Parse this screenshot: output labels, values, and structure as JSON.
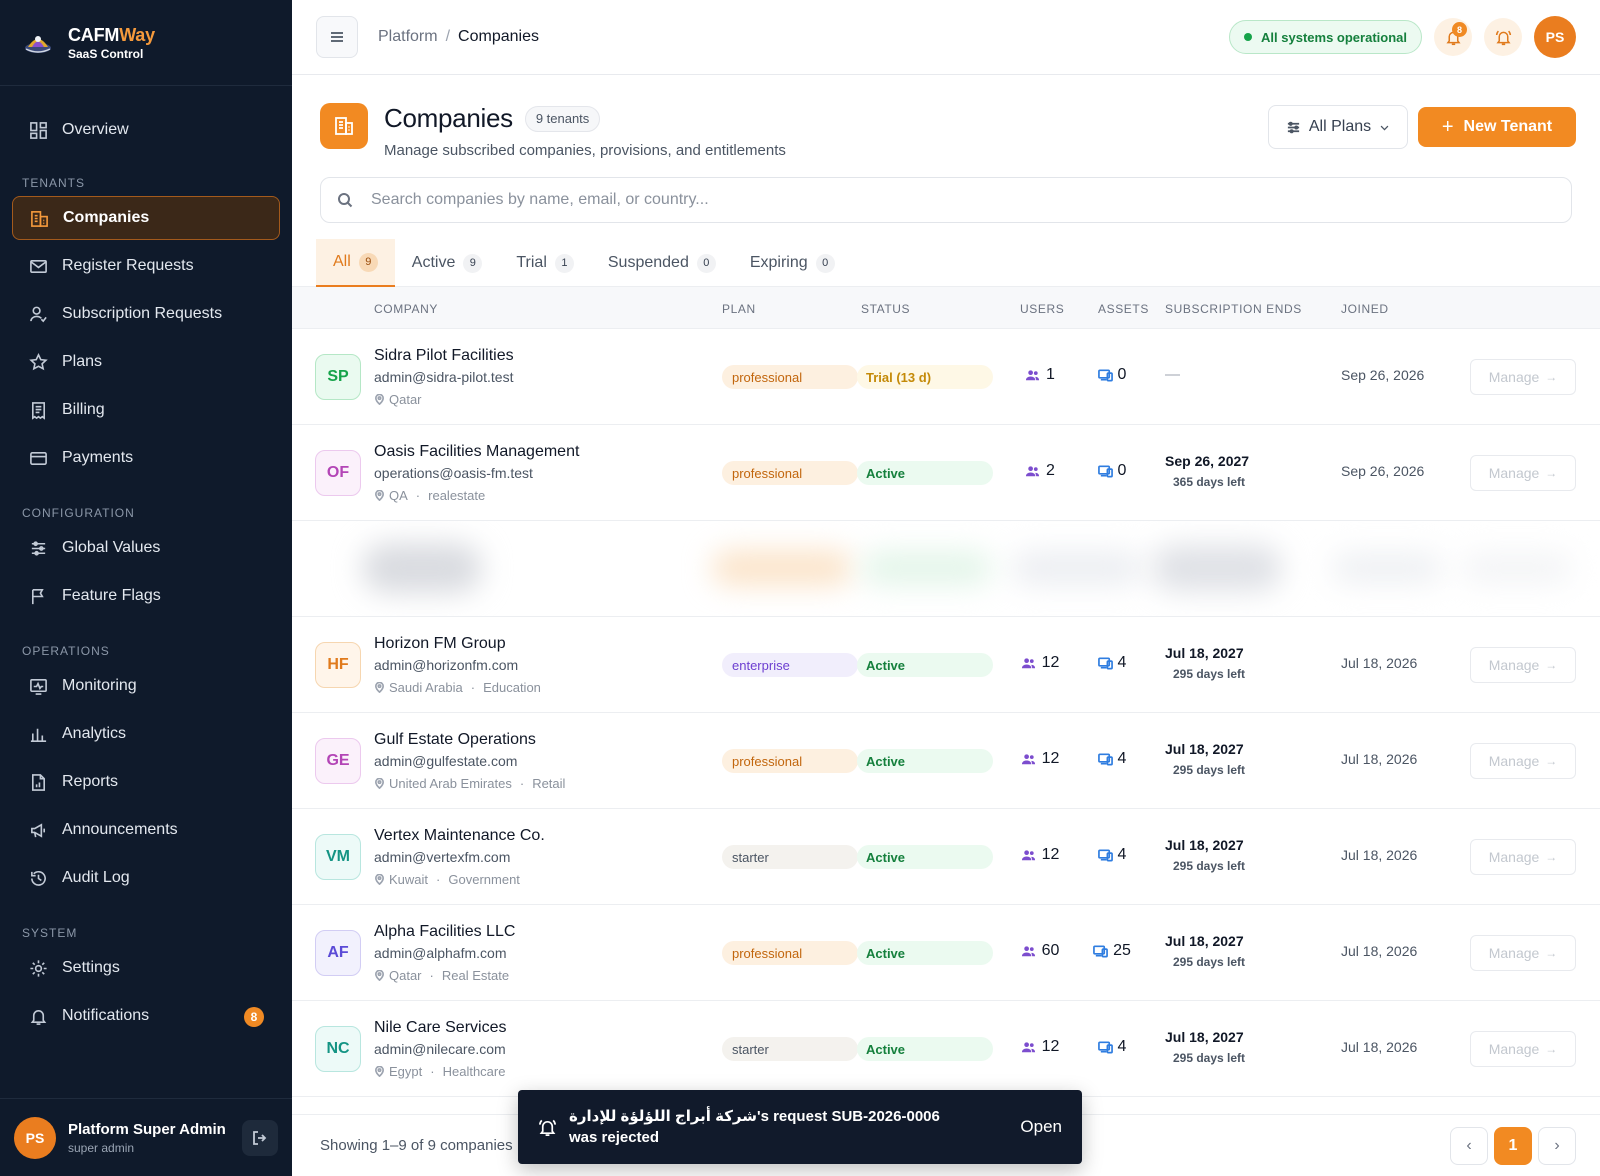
{
  "brand": {
    "name_main": "CAFM",
    "name_accent": "Way",
    "subtitle": "SaaS Control"
  },
  "sidebar": {
    "overview": "Overview",
    "sections": {
      "tenants": "TENANTS",
      "configuration": "CONFIGURATION",
      "operations": "OPERATIONS",
      "system": "SYSTEM"
    },
    "items": {
      "companies": "Companies",
      "register_requests": "Register Requests",
      "subscription_requests": "Subscription Requests",
      "plans": "Plans",
      "billing": "Billing",
      "payments": "Payments",
      "global_values": "Global Values",
      "feature_flags": "Feature Flags",
      "monitoring": "Monitoring",
      "analytics": "Analytics",
      "reports": "Reports",
      "announcements": "Announcements",
      "audit_log": "Audit Log",
      "settings": "Settings",
      "notifications": "Notifications"
    },
    "notifications_badge": "8",
    "user": {
      "initials": "PS",
      "name": "Platform Super Admin",
      "role": "super admin"
    }
  },
  "topbar": {
    "breadcrumb_root": "Platform",
    "breadcrumb_sep": "/",
    "breadcrumb_current": "Companies",
    "system_status": "All systems operational",
    "notif_count": "8",
    "user_initials": "PS"
  },
  "page": {
    "title": "Companies",
    "count_chip": "9 tenants",
    "subtitle": "Manage subscribed companies, provisions, and entitlements",
    "plans_filter": "All Plans",
    "new_button": "New Tenant",
    "search_placeholder": "Search companies by name, email, or country..."
  },
  "tabs": [
    {
      "label": "All",
      "count": "9"
    },
    {
      "label": "Active",
      "count": "9"
    },
    {
      "label": "Trial",
      "count": "1"
    },
    {
      "label": "Suspended",
      "count": "0"
    },
    {
      "label": "Expiring",
      "count": "0"
    }
  ],
  "columns": {
    "company": "COMPANY",
    "plan": "PLAN",
    "status": "STATUS",
    "users": "USERS",
    "assets": "ASSETS",
    "subscription_ends": "SUBSCRIPTION ENDS",
    "joined": "JOINED"
  },
  "rows": [
    {
      "initials": "SP",
      "name": "Sidra Pilot Facilities",
      "email": "admin@sidra-pilot.test",
      "country": "Qatar",
      "sector": "",
      "plan": "professional",
      "status": "Trial (13 d)",
      "users": "1",
      "assets": "0",
      "sub_date": "",
      "sub_left": "",
      "sub_dash": "—",
      "joined": "Sep 26, 2026",
      "manage": "Manage"
    },
    {
      "initials": "OF",
      "name": "Oasis Facilities Management",
      "email": "operations@oasis-fm.test",
      "country": "QA",
      "sector": "realestate",
      "plan": "professional",
      "status": "Active",
      "users": "2",
      "assets": "0",
      "sub_date": "Sep 26, 2027",
      "sub_left": "365 days left",
      "sub_dash": "",
      "joined": "Sep 26, 2026",
      "manage": "Manage"
    },
    {
      "initials": "HF",
      "name": "Horizon FM Group",
      "email": "admin@horizonfm.com",
      "country": "Saudi Arabia",
      "sector": "Education",
      "plan": "enterprise",
      "status": "Active",
      "users": "12",
      "assets": "4",
      "sub_date": "Jul 18, 2027",
      "sub_left": "295 days left",
      "sub_dash": "",
      "joined": "Jul 18, 2026",
      "manage": "Manage"
    },
    {
      "initials": "GE",
      "name": "Gulf Estate Operations",
      "email": "admin@gulfestate.com",
      "country": "United Arab Emirates",
      "sector": "Retail",
      "plan": "professional",
      "status": "Active",
      "users": "12",
      "assets": "4",
      "sub_date": "Jul 18, 2027",
      "sub_left": "295 days left",
      "sub_dash": "",
      "joined": "Jul 18, 2026",
      "manage": "Manage"
    },
    {
      "initials": "VM",
      "name": "Vertex Maintenance Co.",
      "email": "admin@vertexfm.com",
      "country": "Kuwait",
      "sector": "Government",
      "plan": "starter",
      "status": "Active",
      "users": "12",
      "assets": "4",
      "sub_date": "Jul 18, 2027",
      "sub_left": "295 days left",
      "sub_dash": "",
      "joined": "Jul 18, 2026",
      "manage": "Manage"
    },
    {
      "initials": "AF",
      "name": "Alpha Facilities LLC",
      "email": "admin@alphafm.com",
      "country": "Qatar",
      "sector": "Real Estate",
      "plan": "professional",
      "status": "Active",
      "users": "60",
      "assets": "25",
      "sub_date": "Jul 18, 2027",
      "sub_left": "295 days left",
      "sub_dash": "",
      "joined": "Jul 18, 2026",
      "manage": "Manage"
    },
    {
      "initials": "NC",
      "name": "Nile Care Services",
      "email": "admin@nilecare.com",
      "country": "Egypt",
      "sector": "Healthcare",
      "plan": "starter",
      "status": "Active",
      "users": "12",
      "assets": "4",
      "sub_date": "Jul 18, 2027",
      "sub_left": "295 days left",
      "sub_dash": "",
      "joined": "Jul 18, 2026",
      "manage": "Manage"
    }
  ],
  "footer": {
    "showing": "Showing 1–9 of 9 companies",
    "page": "1",
    "prev": "‹",
    "next": "›"
  },
  "toast": {
    "message": "شركة أبراج اللؤلؤة للإدارة's request SUB-2026-0006 was rejected",
    "action": "Open"
  },
  "colors": {
    "accent": "#f28a22",
    "sidebar_bg": "#0f1a2b",
    "success": "#15803d"
  }
}
